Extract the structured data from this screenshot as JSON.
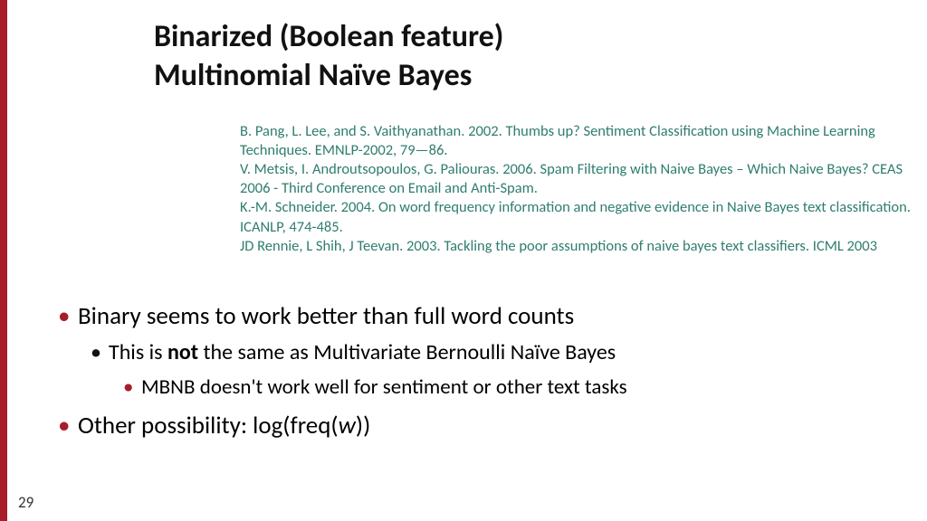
{
  "title": {
    "line1": "Binarized (Boolean feature)",
    "line2": "Multinomial Naïve Bayes"
  },
  "references": [
    "B. Pang, L. Lee, and S. Vaithyanathan.  2002.  Thumbs up? Sentiment Classification using Machine Learning Techniques. EMNLP-2002, 79—86.",
    "V. Metsis, I. Androutsopoulos, G. Paliouras. 2006. Spam Filtering with Naive Bayes – Which Naive Bayes? CEAS 2006 - Third Conference on Email and Anti-Spam.",
    "K.-M. Schneider. 2004. On word frequency information and negative evidence in Naive Bayes text classification. ICANLP, 474-485.",
    "JD Rennie, L Shih, J Teevan. 2003. Tackling the poor assumptions of naive bayes text classifiers. ICML 2003"
  ],
  "bullets": {
    "b1": "Binary seems to work better than full word counts",
    "b1a_pre": "This is ",
    "b1a_bold": "not",
    "b1a_post": " the same as Multivariate Bernoulli Naïve Bayes",
    "b1a_i": "MBNB doesn't work well for sentiment or other text tasks",
    "b2_pre": "Other possibility: log(freq(",
    "b2_ital": "w",
    "b2_post": "))"
  },
  "page_number": "29"
}
